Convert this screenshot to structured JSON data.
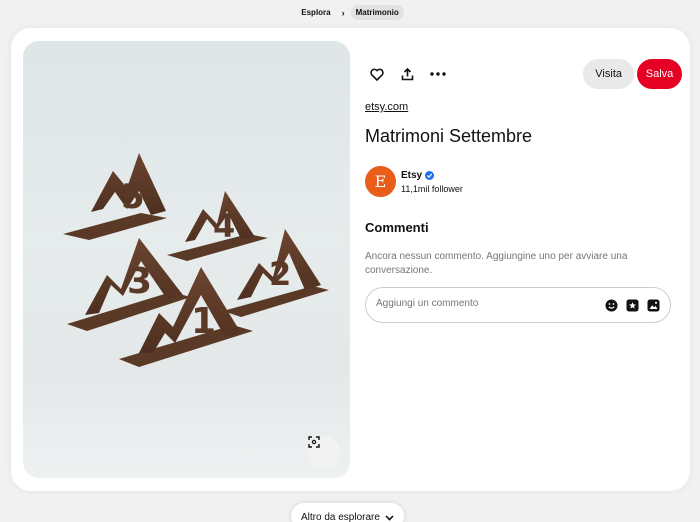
{
  "breadcrumb": {
    "items": [
      "Esplora",
      "Matrimonio"
    ],
    "separator": "›"
  },
  "pin": {
    "domain": "etsy.com",
    "title": "Matrimoni Settembre",
    "image_numbers": [
      "5",
      "4",
      "3",
      "2",
      "1"
    ]
  },
  "actions": {
    "like_icon": "heart-icon",
    "share_icon": "share-icon",
    "more_icon": "more-icon",
    "visit_label": "Visita",
    "save_label": "Salva"
  },
  "creator": {
    "avatar_letter": "E",
    "name": "Etsy",
    "followers": "11,1mil follower",
    "avatar_color": "#e95c1a"
  },
  "comments": {
    "heading": "Commenti",
    "empty_text": "Ancora nessun commento. Aggiungine uno per avviare una conversazione.",
    "placeholder": "Aggiungi un commento"
  },
  "footer": {
    "explore_label": "Altro da esplorare"
  },
  "colors": {
    "save": "#e60023",
    "verified": "#1d72e6"
  }
}
